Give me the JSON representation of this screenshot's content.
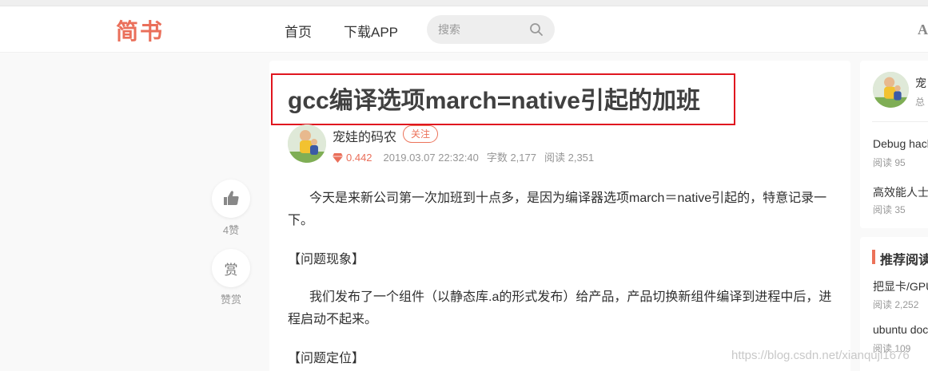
{
  "header": {
    "logo": "简书",
    "nav": [
      "首页",
      "下载APP"
    ],
    "search_placeholder": "搜索",
    "font_toggle": "A"
  },
  "article": {
    "title": "gcc编译选项march=native引起的加班",
    "author": "宠娃的码农",
    "follow_label": "关注",
    "score": "0.442",
    "date": "2019.03.07 22:32:40",
    "word_count": "字数 2,177",
    "reads": "阅读 2,351",
    "paragraphs": [
      "今天是来新公司第一次加班到十点多，是因为编译器选项march＝native引起的，特意记录一下。",
      "【问题现象】",
      "我们发布了一个组件（以静态库.a的形式发布）给产品，产品切换新组件编译到进程中后，进程启动不起来。",
      "【问题定位】"
    ]
  },
  "actions": {
    "like_label": "4赞",
    "reward_char": "赏",
    "reward_label": "赞赏"
  },
  "sidebar": {
    "author_name": "宠",
    "author_sub": "总",
    "items": [
      {
        "title": "Debug hack",
        "reads": "阅读 95"
      },
      {
        "title": "高效能人士",
        "reads": "阅读 35"
      }
    ],
    "recommend_title": "推荐阅读",
    "recommend": [
      {
        "title": "把显卡/GPU",
        "reads": "阅读 2,252"
      },
      {
        "title": "ubuntu doc",
        "reads": "阅读 109"
      }
    ]
  },
  "watermark": "https://blog.csdn.net/xianquji1676"
}
